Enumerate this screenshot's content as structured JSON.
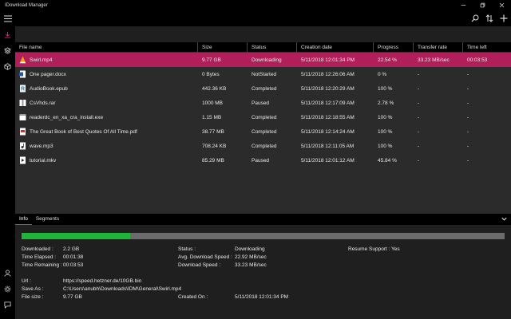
{
  "window": {
    "title": "IDownload Manager"
  },
  "table": {
    "headers": [
      "File name",
      "Size",
      "Status",
      "Creation date",
      "Progress",
      "Transfer rate",
      "Time left"
    ],
    "rows": [
      {
        "icon": "vlc-icon",
        "name": "Swirl.mp4",
        "size": "9.77 GB",
        "status": "Downloading",
        "date": "5/11/2018 12:01:34 PM",
        "progress": "22.54 %",
        "rate": "33.23 MB/sec",
        "left": "00:03:53",
        "selected": true
      },
      {
        "icon": "word-icon",
        "name": "One pager.docx",
        "size": "0 Bytes",
        "status": "NotStarted",
        "date": "5/11/2018 12:26:06 AM",
        "progress": "0 %",
        "rate": "-",
        "left": "-"
      },
      {
        "icon": "epub-icon",
        "name": "AudioBook.epub",
        "size": "442.36 KB",
        "status": "Completed",
        "date": "5/11/2018 12:20:29 AM",
        "progress": "100 %",
        "rate": "-",
        "left": "-"
      },
      {
        "icon": "archive-icon",
        "name": "CsVhds.rar",
        "size": "1000 MB",
        "status": "Paused",
        "date": "5/11/2018 12:17:09 AM",
        "progress": "2.78 %",
        "rate": "-",
        "left": "-"
      },
      {
        "icon": "exe-icon",
        "name": "readerdc_en_xa_cra_install.exe",
        "size": "1.15 MB",
        "status": "Completed",
        "date": "5/11/2018 12:18:55 AM",
        "progress": "100 %",
        "rate": "-",
        "left": "-"
      },
      {
        "icon": "pdf-icon",
        "name": "The Great Book of Best Quotes Of All Time.pdf",
        "size": "38.77 MB",
        "status": "Completed",
        "date": "5/11/2018 12:14:24 AM",
        "progress": "100 %",
        "rate": "-",
        "left": "-"
      },
      {
        "icon": "audio-icon",
        "name": "wave.mp3",
        "size": "708.24 KB",
        "status": "Completed",
        "date": "5/11/2018 12:11:05 AM",
        "progress": "100 %",
        "rate": "-",
        "left": "-"
      },
      {
        "icon": "video-icon",
        "name": "tutorial.mkv",
        "size": "85.29 MB",
        "status": "Paused",
        "date": "5/11/2018 12:01:12 AM",
        "progress": "45.84 %",
        "rate": "-",
        "left": "-"
      }
    ]
  },
  "details": {
    "tabs": [
      "Info",
      "Segments"
    ],
    "progress_fraction": 0.2254,
    "downloaded_label": "Downloaded :",
    "downloaded": "2.2 GB",
    "elapsed_label": "Time Elapsed :",
    "elapsed": "00:01:38",
    "remaining_label": "Time Remaining :",
    "remaining": "00:03:53",
    "status_label": "Status :",
    "status": "Downloading",
    "avg_label": "Avg. Download Speed :",
    "avg": "22.92 MB/sec",
    "speed_label": "Download Speed :",
    "speed": "33.23 MB/sec",
    "resume_label": "Resume Support :",
    "resume": "Yes",
    "url_label": "Url :",
    "url": "https://speed.hetzner.de/10GB.bin",
    "saveas_label": "Save As :",
    "saveas": "C:\\Users\\anubh\\Downloads\\IDM\\General\\Swirl.mp4",
    "filesize_label": "File size :",
    "filesize": "9.77 GB",
    "created_label": "Created On :",
    "created": "5/11/2018 12:01:34 PM"
  },
  "colors": {
    "accent": "#e0287a",
    "selected_row": "#b01f5a",
    "progress": "#1fb53a"
  }
}
